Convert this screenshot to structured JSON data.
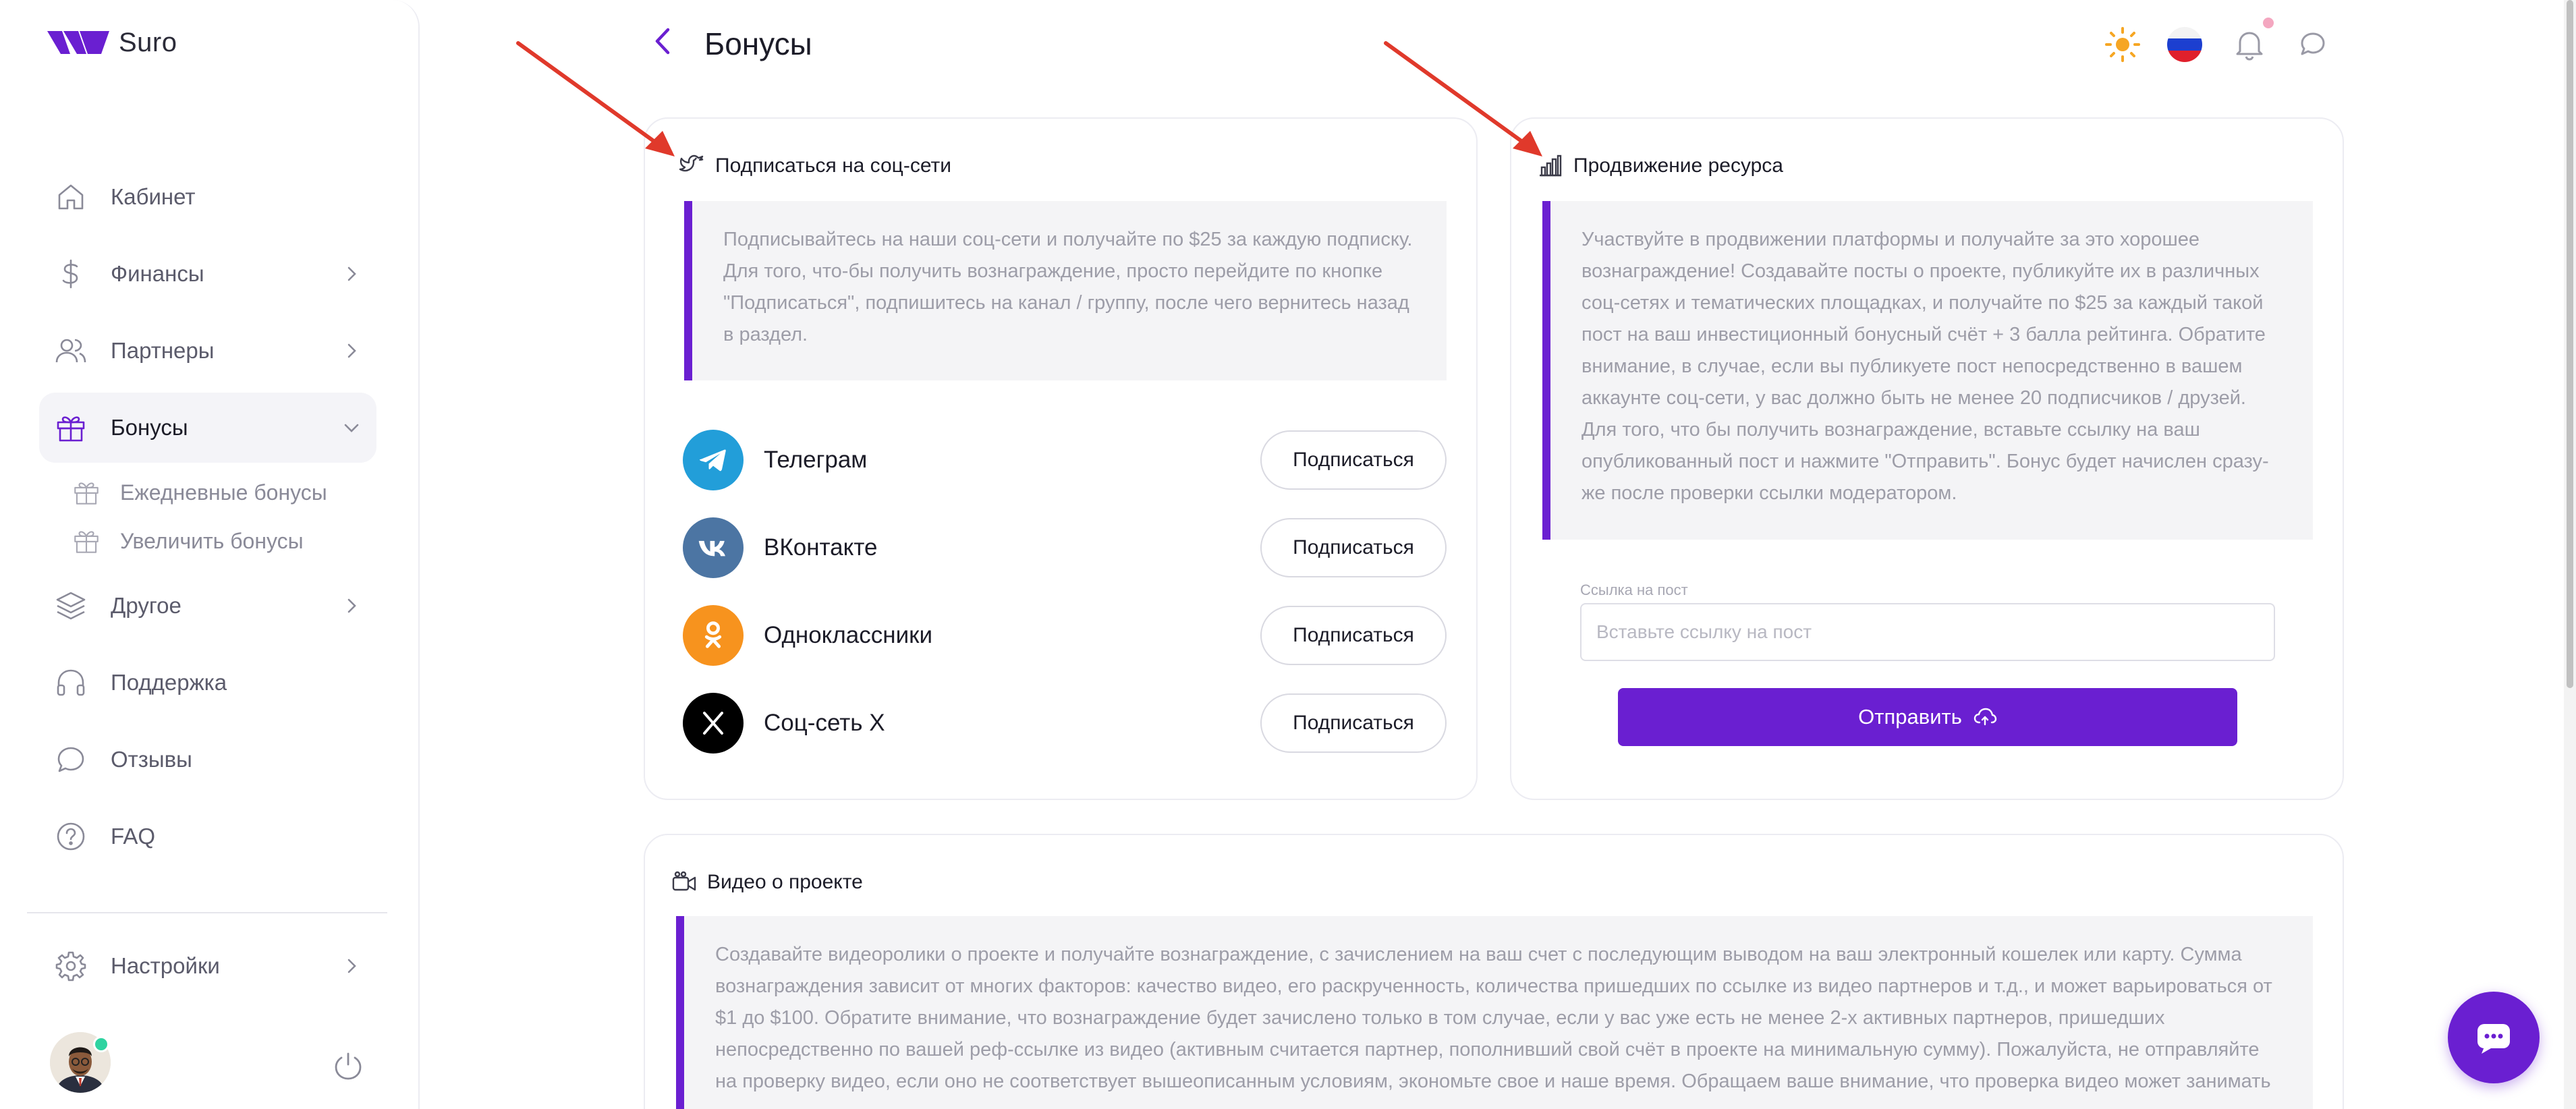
{
  "app": {
    "name": "Suro"
  },
  "header": {
    "title": "Бонусы"
  },
  "sidebar": {
    "items": [
      {
        "label": "Кабинет",
        "icon": "home-icon"
      },
      {
        "label": "Финансы",
        "icon": "dollar-icon"
      },
      {
        "label": "Партнеры",
        "icon": "users-icon"
      },
      {
        "label": "Бонусы",
        "icon": "gift-icon"
      },
      {
        "label": "Другое",
        "icon": "layers-icon"
      },
      {
        "label": "Поддержка",
        "icon": "headphones-icon"
      },
      {
        "label": "Отзывы",
        "icon": "message-icon"
      },
      {
        "label": "FAQ",
        "icon": "help-circle-icon"
      }
    ],
    "sub_items": [
      {
        "label": "Ежедневные бонусы",
        "icon": "gift-icon"
      },
      {
        "label": "Увеличить бонусы",
        "icon": "gift-icon"
      }
    ],
    "settings_label": "Настройки"
  },
  "cards": {
    "social": {
      "title": "Подписаться на соц-сети",
      "description": "Подписывайтесь на наши соц-сети и получайте по $25 за каждую подписку. Для того, что-бы получить вознаграждение, просто перейдите по кнопке \"Подписаться\", подпишитесь на канал / группу, после чего вернитесь назад в раздел.",
      "networks": [
        {
          "name": "Телеграм",
          "button": "Подписаться",
          "color": "#229ed9"
        },
        {
          "name": "ВКонтакте",
          "button": "Подписаться",
          "color": "#4c75a3"
        },
        {
          "name": "Одноклассники",
          "button": "Подписаться",
          "color": "#f7931e"
        },
        {
          "name": "Соц-сеть X",
          "button": "Подписаться",
          "color": "#000000"
        }
      ]
    },
    "promotion": {
      "title": "Продвижение ресурса",
      "description": "Участвуйте в продвижении платформы и получайте за это хорошее вознаграждение! Создавайте посты о проекте, публикуйте их в различных соц-сетях и тематических площадках, и получайте по $25 за каждый такой пост на ваш инвестиционный бонусный счёт + 3 балла рейтинга. Обратите внимание, в случае, если вы публикуете пост непосредственно в вашем аккаунте соц-сети, у вас должно быть не менее 20 подписчиков / друзей. Для того, что бы получить вознаграждение, вставьте ссылку на ваш опубликованный пост и нажмите \"Отправить\". Бонус будет начислен сразу-же после проверки ссылки модератором.",
      "field_label": "Ссылка на пост",
      "field_placeholder": "Вставьте ссылку на пост",
      "field_value": "",
      "submit_label": "Отправить"
    },
    "video": {
      "title": "Видео о проекте",
      "description": "Создавайте видеоролики о проекте и получайте вознаграждение, с зачислением на ваш счет с последующим выводом на ваш электронный кошелек или карту. Сумма вознаграждения зависит от многих факторов: качество видео, его раскрученность, количества пришедших по ссылке из видео партнеров и т.д., и может варьироваться от $1 до $100. Обратите внимание, что вознаграждение будет зачислено только в том случае, если у вас уже есть не менее 2-х активных партнеров, пришедших непосредственно по вашей реф-ссылке из видео (активным считается партнер, пополнивший свой счёт в проекте на минимальную сумму). Пожалуйста, не отправляйте на проверку видео, если оно не соответствует вышеописанным условиям, экономьте свое и наше время. Обращаем ваше внимание, что проверка видео может занимать"
    }
  },
  "colors": {
    "accent": "#6a1fd1",
    "annotation_arrow": "#e0392b",
    "online_status": "#2ed3a0"
  }
}
